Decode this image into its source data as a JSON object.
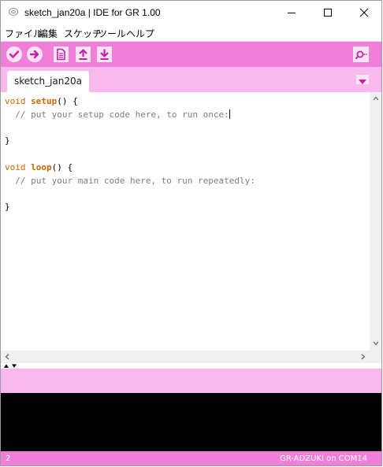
{
  "window": {
    "title": "sketch_jan20a | IDE for GR 1.00",
    "controls": [
      "minimize",
      "maximize",
      "close"
    ]
  },
  "menu": {
    "items": [
      "ファイル",
      "編集",
      "スケッチ",
      "ツール",
      "ヘルプ"
    ]
  },
  "toolbar": {
    "buttons": [
      "verify-icon",
      "upload-icon",
      "new-icon",
      "open-icon",
      "save-icon"
    ],
    "right_button": "serial-monitor-icon"
  },
  "tabs": {
    "items": [
      {
        "label": "sketch_jan20a",
        "active": true
      }
    ],
    "menu_icon": "tab-menu-dropdown-icon"
  },
  "editor": {
    "lines": [
      "void setup() {",
      "  // put your setup code here, to run once:",
      "",
      "}",
      "",
      "void loop() {",
      "  // put your main code here, to run repeatedly:",
      "",
      "}"
    ]
  },
  "footer": {
    "line_number": "2",
    "board_info": "GR-ADZUKI on COM14"
  },
  "colors": {
    "toolbar": "#f07fd9",
    "tabs_bg": "#f9b9ee",
    "button_bg": "#fbe3f6",
    "keyword": "#cc6600",
    "comment": "#7e7e7e",
    "console_bg": "#000000"
  }
}
